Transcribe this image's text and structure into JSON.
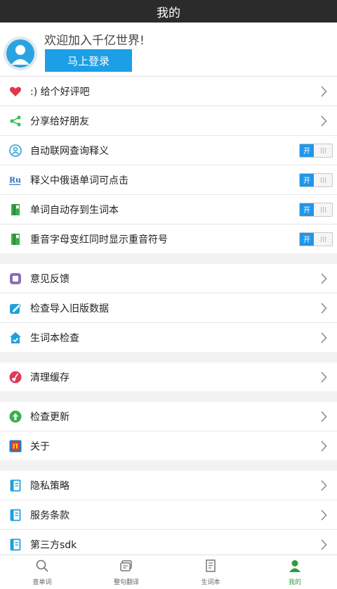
{
  "header": {
    "title": "我的"
  },
  "profile": {
    "welcome": "欢迎加入千亿世界!",
    "login_label": "马上登录"
  },
  "sections": [
    [
      {
        "label": ":) 给个好评吧",
        "icon": "heart-icon",
        "control": "chevron"
      },
      {
        "label": "分享给好朋友",
        "icon": "share-icon",
        "control": "chevron"
      },
      {
        "label": "自动联网查询释义",
        "icon": "network-icon",
        "control": "toggle"
      },
      {
        "label": "释义中俄语单词可点击",
        "icon": "ru-icon",
        "control": "toggle"
      },
      {
        "label": "单词自动存到生词本",
        "icon": "book-save-icon",
        "control": "toggle"
      },
      {
        "label": "重音字母变红同时显示重音符号",
        "icon": "book-accent-icon",
        "control": "toggle"
      }
    ],
    [
      {
        "label": "意见反馈",
        "icon": "feedback-icon",
        "control": "chevron"
      },
      {
        "label": "检查导入旧版数据",
        "icon": "import-icon",
        "control": "chevron"
      },
      {
        "label": "生词本检查",
        "icon": "vocab-check-icon",
        "control": "chevron"
      }
    ],
    [
      {
        "label": "清理缓存",
        "icon": "broom-icon",
        "control": "chevron"
      }
    ],
    [
      {
        "label": "检查更新",
        "icon": "update-icon",
        "control": "chevron"
      },
      {
        "label": "关于",
        "icon": "about-logo-icon",
        "control": "chevron"
      }
    ],
    [
      {
        "label": "隐私策略",
        "icon": "document-icon",
        "control": "chevron"
      },
      {
        "label": "服务条款",
        "icon": "document-icon",
        "control": "chevron"
      },
      {
        "label": "第三方sdk",
        "icon": "document-icon",
        "control": "chevron"
      }
    ]
  ],
  "toggle_on_text": "开",
  "tabs": [
    {
      "label": "查单词",
      "icon": "search-icon",
      "active": false
    },
    {
      "label": "整句翻译",
      "icon": "translate-icon",
      "active": false
    },
    {
      "label": "生词本",
      "icon": "notebook-icon",
      "active": false
    },
    {
      "label": "我的",
      "icon": "person-icon",
      "active": true
    }
  ],
  "colors": {
    "accent": "#1c9fe6",
    "active_tab": "#2f9c3f",
    "header_bg": "#2b2b2b"
  }
}
